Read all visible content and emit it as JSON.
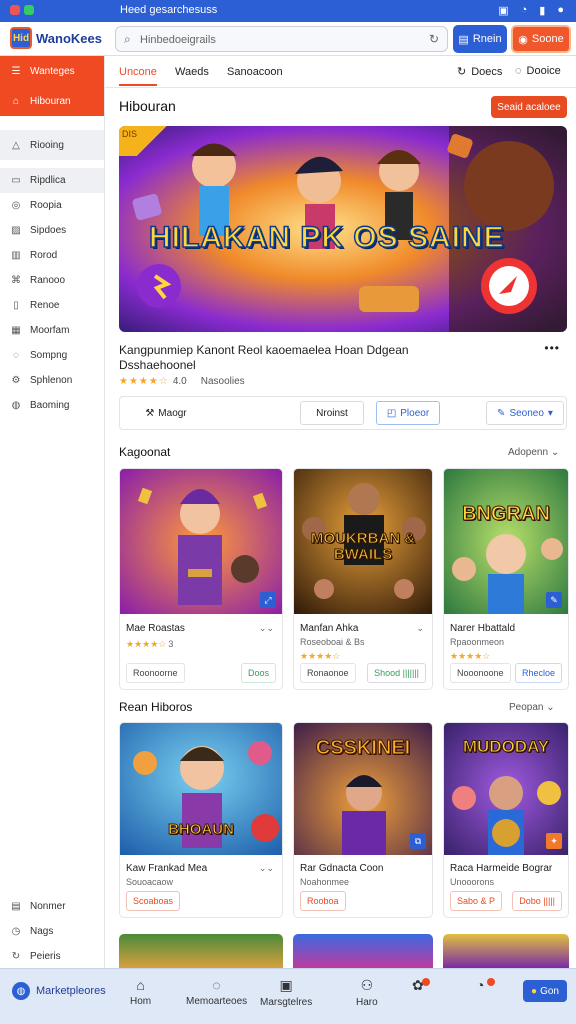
{
  "status_bar": {
    "text": "Нeed gesarchesuss"
  },
  "header": {
    "logo_mark": "Hid",
    "logo_name": "WanoKees",
    "search_placeholder": "Hinbedoeigrails",
    "btn_primary": "Rnein",
    "btn_secondary": "Soone"
  },
  "sidebar": {
    "items": [
      {
        "icon": "list-icon",
        "label": "Wanteges"
      },
      {
        "icon": "home-icon",
        "label": "Hibouran"
      },
      {
        "icon": "bell-icon",
        "label": "Riooing"
      },
      {
        "icon": "doc-icon",
        "label": "Ripdlica"
      },
      {
        "icon": "target-icon",
        "label": "Roopia"
      },
      {
        "icon": "photo-icon",
        "label": "Sipdoes"
      },
      {
        "icon": "chart-icon",
        "label": "Rorod"
      },
      {
        "icon": "tag-icon",
        "label": "Ranooo"
      },
      {
        "icon": "file-icon",
        "label": "Renoe"
      },
      {
        "icon": "grid-icon",
        "label": "Moorfam"
      },
      {
        "icon": "chat-icon",
        "label": "Sompng"
      },
      {
        "icon": "settings-icon",
        "label": "Sphlenon"
      },
      {
        "icon": "globe-icon",
        "label": "Baoming"
      }
    ],
    "bottom": [
      {
        "icon": "print-icon",
        "label": "Nonmer"
      },
      {
        "icon": "clock-icon",
        "label": "Nags"
      },
      {
        "icon": "refresh-icon",
        "label": "Peieris"
      }
    ]
  },
  "tabs": {
    "items": [
      "Uncone",
      "Waeds",
      "Sanoacoon"
    ],
    "right1": "Doecs",
    "right2": "Dooice"
  },
  "featured": {
    "section_title": "Hibouran",
    "cta": "Seaid acaloee",
    "hero_title": "HILAKAN PK OS SAINE",
    "ribbon": "DIS",
    "description_line1": "Kangpunmiep Kanont Reol kaoemaelea Hoan Ddgean",
    "description_line2": "Dsshaehoonel",
    "rating_value": "4.0",
    "rating_count": "Nasoolies",
    "actions": {
      "a1": "Maogr",
      "a2": "Nroinst",
      "a3": "Ploeor",
      "a4": "Seoneo"
    }
  },
  "row1": {
    "title": "Kagoonat",
    "more": "Adopenn",
    "cards": [
      {
        "title": "Mae Roastas",
        "sub": "",
        "stars": "★★★★☆",
        "rating": "3",
        "btn1": "Roonoorne",
        "btn2": "Doos",
        "img_title": ""
      },
      {
        "title": "Manfan Ahka",
        "sub": "Roseoboai & Bs",
        "stars": "★★★★☆",
        "rating": "",
        "btn1": "Ronaonoe",
        "btn2": "Shood |||||||",
        "img_title": "MOUKRBAN & BWAILS"
      },
      {
        "title": "Narer Hbattald",
        "sub": "Rpaoonmeon",
        "stars": "★★★★☆",
        "rating": "",
        "btn1": "Nooonoone",
        "btn2": "Rhecloe",
        "img_title": "BNGRAN"
      }
    ]
  },
  "row2": {
    "title": "Rean Hiboros",
    "more": "Peopan",
    "cards": [
      {
        "title": "Kaw Frankad Mea",
        "sub": "Souoacaow",
        "btn1": "Scoaboas",
        "btn2": "",
        "img_title": "BHOAUN"
      },
      {
        "title": "Rar Gdnacta Coon",
        "sub": "Noahonmee",
        "btn1": "Rooboa",
        "btn2": "",
        "img_title": "CSSKINEI"
      },
      {
        "title": "Raca Harmeide Bograr",
        "sub": "Unooorons",
        "btn1": "Sabo & P",
        "btn2": "Dobo |||||",
        "img_title": "MUDODAY"
      }
    ]
  },
  "bottom_nav": {
    "market_label": "Marketpleores",
    "items": [
      {
        "icon": "home-icon",
        "label": "Hom"
      },
      {
        "icon": "message-icon",
        "label": "Memoarteoes"
      },
      {
        "icon": "bag-icon",
        "label": "Marsgtelres"
      },
      {
        "icon": "user-icon",
        "label": "Haro"
      },
      {
        "icon": "gift-icon",
        "label": ""
      },
      {
        "icon": "compass-icon",
        "label": ""
      }
    ],
    "cta": "Gon"
  },
  "colors": {
    "accent": "#f04a23",
    "brand": "#2c5fd4"
  }
}
